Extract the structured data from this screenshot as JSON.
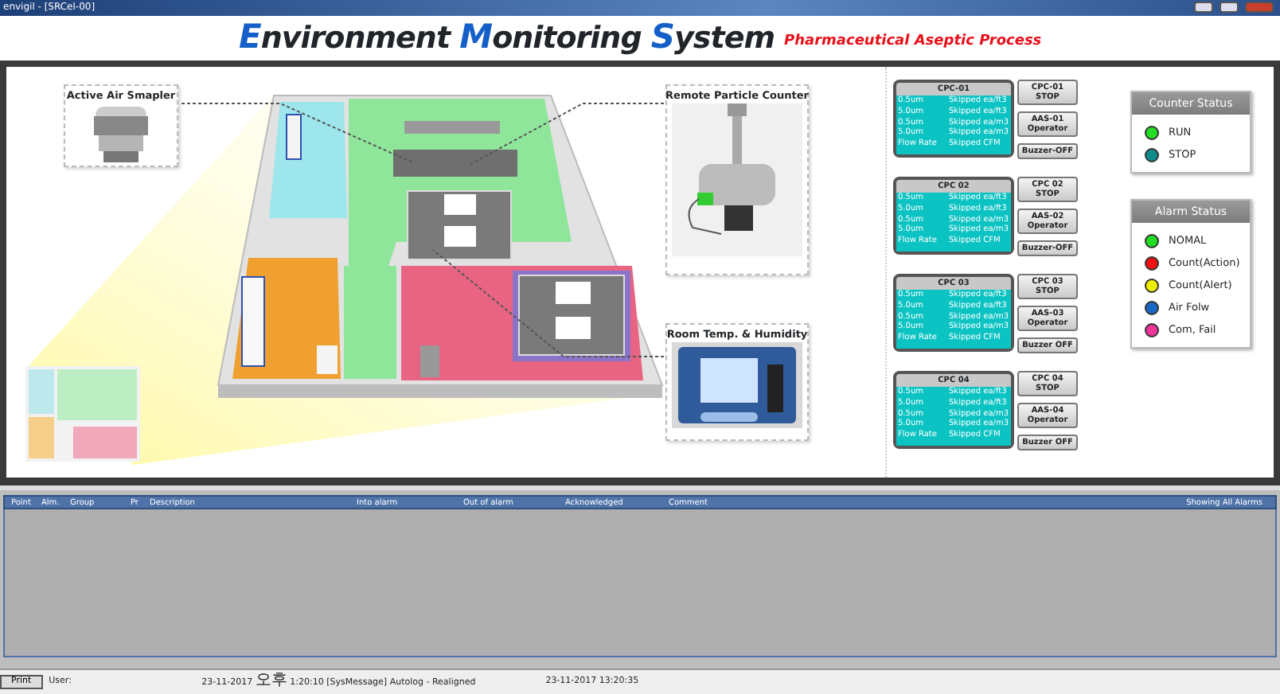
{
  "window": {
    "title": "envigil - [SRCel-00]"
  },
  "header": {
    "title_parts": [
      {
        "text": "E",
        "kind": "accent"
      },
      {
        "text": "nvironment ",
        "kind": "plain"
      },
      {
        "text": "M",
        "kind": "accent"
      },
      {
        "text": "onitoring ",
        "kind": "plain"
      },
      {
        "text": "S",
        "kind": "accent"
      },
      {
        "text": "ystem",
        "kind": "plain"
      }
    ],
    "subtitle": "Pharmaceutical Aseptic Process"
  },
  "plan": {
    "callouts": [
      {
        "label": "Active Air Smapler",
        "kind": "sampler"
      },
      {
        "label": "Remote Particle Counter",
        "kind": "counter"
      },
      {
        "label": "Room Temp. & Humidity",
        "kind": "sensor"
      }
    ]
  },
  "counters": [
    {
      "title": "CPC-01",
      "rows": [
        {
          "label": "0.5um",
          "value": "Skipped ea/ft3"
        },
        {
          "label": "5.0um",
          "value": "Skipped ea/ft3"
        },
        {
          "label": "0.5um",
          "value": "Skipped ea/m3"
        },
        {
          "label": "5.0um",
          "value": "Skipped ea/m3"
        },
        {
          "label": "Flow Rate",
          "value": "Skipped CFM"
        }
      ],
      "buttons": [
        "CPC-01 STOP",
        "AAS-01 Operator",
        "Buzzer-OFF"
      ]
    },
    {
      "title": "CPC 02",
      "rows": [
        {
          "label": "0.5um",
          "value": "Skipped ea/ft3"
        },
        {
          "label": "5.0um",
          "value": "Skipped ea/ft3"
        },
        {
          "label": "0.5um",
          "value": "Skipped ea/m3"
        },
        {
          "label": "5.0um",
          "value": "Skipped ea/m3"
        },
        {
          "label": "Flow Rate",
          "value": "Skipped CFM"
        }
      ],
      "buttons": [
        "CPC 02 STOP",
        "AAS-02 Operator",
        "Buzzer-OFF"
      ]
    },
    {
      "title": "CPC 03",
      "rows": [
        {
          "label": "0.5um",
          "value": "Skipped ea/ft3"
        },
        {
          "label": "5.0um",
          "value": "Skipped ea/ft3"
        },
        {
          "label": "0.5um",
          "value": "Skipped ea/m3"
        },
        {
          "label": "5.0um",
          "value": "Skipped ea/m3"
        },
        {
          "label": "Flow Rate",
          "value": "Skipped CFM"
        }
      ],
      "buttons": [
        "CPC 03 STOP",
        "AAS-03 Operator",
        "Buzzer OFF"
      ]
    },
    {
      "title": "CPC 04",
      "rows": [
        {
          "label": "0.5um",
          "value": "Skipped ea/ft3"
        },
        {
          "label": "5.0um",
          "value": "Skipped ea/ft3"
        },
        {
          "label": "0.5um",
          "value": "Skipped ea/m3"
        },
        {
          "label": "5.0um",
          "value": "Skipped ea/m3"
        },
        {
          "label": "Flow Rate",
          "value": "Skipped CFM"
        }
      ],
      "buttons": [
        "CPC 04 STOP",
        "AAS-04 Operator",
        "Buzzer OFF"
      ]
    }
  ],
  "legends": [
    {
      "title": "Counter Status",
      "items": [
        {
          "label": "RUN",
          "color": "#22dd22"
        },
        {
          "label": "STOP",
          "color": "#108c8c"
        }
      ]
    },
    {
      "title": "Alarm Status",
      "items": [
        {
          "label": "NOMAL",
          "color": "#22dd22"
        },
        {
          "label": "Count(Action)",
          "color": "#ee1111"
        },
        {
          "label": "Count(Alert)",
          "color": "#eeee00"
        },
        {
          "label": "Air Folw",
          "color": "#1a66c4"
        },
        {
          "label": "Com, Fail",
          "color": "#ee3399"
        }
      ]
    }
  ],
  "alarms": {
    "columns": [
      "Point",
      "Alm.",
      "Group",
      "Pr",
      "Description",
      "Into alarm",
      "Out of alarm",
      "Acknowledged",
      "Comment"
    ],
    "filter": "Showing All Alarms"
  },
  "status_bar": {
    "button": "Print",
    "user": "User:",
    "message": "23-11-2017 오후 1:20:10 [SysMessage] Autolog - Realigned",
    "time": "23-11-2017 13:20:35"
  }
}
